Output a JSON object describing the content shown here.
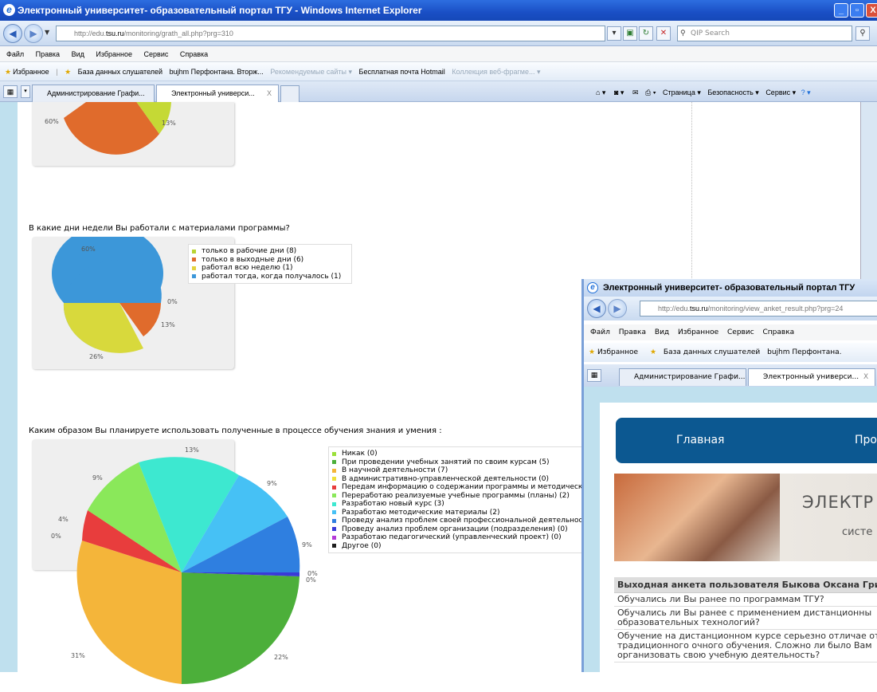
{
  "browser": {
    "title": "Электронный университет- образовательный портал ТГУ - Windows Internet Explorer",
    "url_prefix": "http://edu.",
    "url_domain": "tsu.ru",
    "url_suffix": "/monitoring/grath_all.php?prg=310",
    "search_placeholder": "QIP Search",
    "menu": [
      "Файл",
      "Правка",
      "Вид",
      "Избранное",
      "Сервис",
      "Справка"
    ],
    "favorites_label": "Избранное",
    "favorites": [
      "База данных слушателей",
      "bujhm Перфонтана. Вторж...",
      "Рекомендуемые сайты ▾",
      "Бесплатная почта Hotmail",
      "Коллекция веб-фрагме... ▾"
    ],
    "tabs": [
      "Администрирование Графи...",
      "Электронный универси..."
    ],
    "commands": [
      "Страница ▾",
      "Безопасность ▾",
      "Сервис ▾"
    ]
  },
  "questions": {
    "q1_tail": {
      "label_60": "60%",
      "label_13": "13%"
    },
    "q2": {
      "text": "В какие дни недели Вы работали с материалами программы?",
      "legend": [
        "только в рабочие дни (8)",
        "только в выходные дни (6)",
        "работал всю неделю (1)",
        "работал тогда, когда получалось (1)"
      ],
      "legend_colors": [
        "#b9d332",
        "#e06b2c",
        "#e4d23c",
        "#3c97d9"
      ],
      "pct_labels": [
        "60%",
        "0%",
        "13%",
        "26%"
      ]
    },
    "q3": {
      "text": "Каким образом Вы планируете использовать полученные в процессе обучения знания и умения :",
      "legend": [
        "Никак (0)",
        "При проведении учебных занятий по своим курсам (5)",
        "В научной деятельности (7)",
        "В административно-управленческой деятельности (0)",
        "Передам информацию о содержании программы и методические",
        "Переработаю реализуемые учебные программы (планы) (2)",
        "Разработаю новый курс (3)",
        "Разработаю методические материалы (2)",
        "Проведу анализ проблем своей профессиональной деятельности",
        "Проведу анализ проблем организации (подразделения) (0)",
        "Разработаю педагогический (управленческий проект) (0)",
        "Другое (0)"
      ],
      "legend_colors": [
        "#9be03a",
        "#4caf3a",
        "#f4b53a",
        "#f0e03a",
        "#e83d3d",
        "#8ae85a",
        "#3de8d0",
        "#46c1f5",
        "#2f7fe0",
        "#3a3ad8",
        "#b43ad8",
        "#1e1e1e"
      ],
      "pct_labels": [
        "13%",
        "9%",
        "9%",
        "4%",
        "0%",
        "9%",
        "0%",
        "0%",
        "31%",
        "22%"
      ]
    }
  },
  "window2": {
    "title": "Электронный университет- образовательный портал ТГУ",
    "url_prefix": "http://edu.",
    "url_domain": "tsu.ru",
    "url_suffix": "/monitoring/view_anket_result.php?prg=24",
    "menu": [
      "Файл",
      "Правка",
      "Вид",
      "Избранное",
      "Сервис",
      "Справка"
    ],
    "favorites_label": "Избранное",
    "favorites": [
      "База данных слушателей",
      "bujhm Перфонтана."
    ],
    "tabs": [
      "Администрирование Графи...",
      "Электронный универси..."
    ],
    "nav": [
      "Главная",
      "Про"
    ],
    "banner_title": "ЭЛЕКТР",
    "banner_sub": "систе",
    "anketa_header": "Выходная анкета пользователя Быкова Оксана Гри",
    "anketa_rows": [
      "Обучались ли Вы ранее по программам ТГУ?",
      "Обучались ли Вы ранее с применением дистанционны образовательных технологий?",
      "Обучение на дистанционном курсе серьезно отличае от традиционного очного обучения. Сложно ли было Вам организовать свою учебную деятельность?"
    ]
  }
}
